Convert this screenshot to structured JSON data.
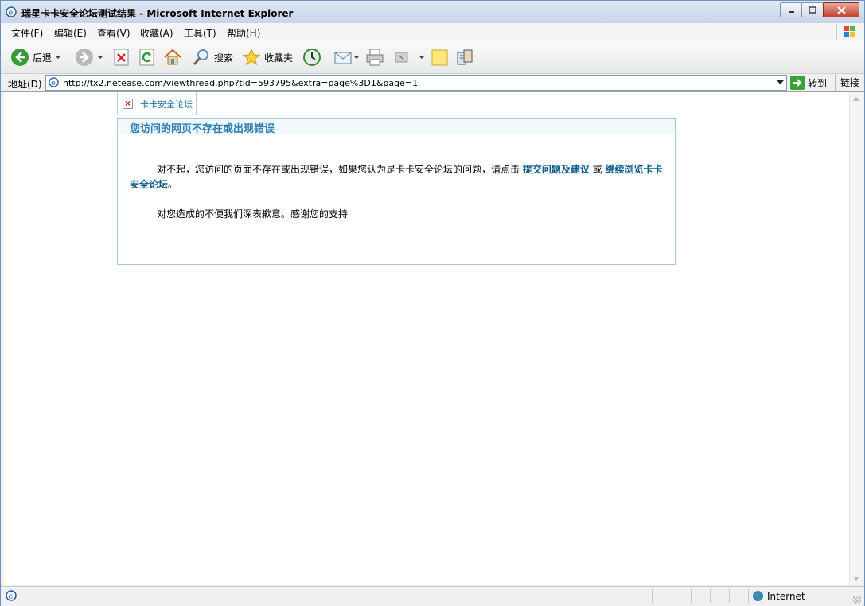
{
  "window": {
    "title": "瑞星卡卡安全论坛测试结果 - Microsoft Internet Explorer"
  },
  "menu": {
    "items": [
      "文件(F)",
      "编辑(E)",
      "查看(V)",
      "收藏(A)",
      "工具(T)",
      "帮助(H)"
    ]
  },
  "toolbar": {
    "back": "后退",
    "search": "搜索",
    "favorites": "收藏夹"
  },
  "address": {
    "label": "地址(D)",
    "url": "http://tx2.netease.com/viewthread.php?tid=593795&extra=page%3D1&page=1",
    "go": "转到",
    "links": "链接"
  },
  "page": {
    "broken_image_alt": "卡卡安全论坛",
    "error_title": "您访问的网页不存在或出现错误",
    "para1_text": "对不起，您访问的页面不存在或出现错误，如果您认为是卡卡安全论坛的问题，请点击 ",
    "link_feedback": "提交问题及建议",
    "para1_or": " 或 ",
    "link_browse": "继续浏览卡卡安全论坛",
    "para1_end": "。",
    "para2_text": "对您造成的不便我们深表歉意。感谢您的支持"
  },
  "status": {
    "zone": "Internet"
  },
  "colors": {
    "title_accent": "#2a7fb7",
    "link": "#0b5e8c",
    "box_border": "#a8c8dc"
  }
}
